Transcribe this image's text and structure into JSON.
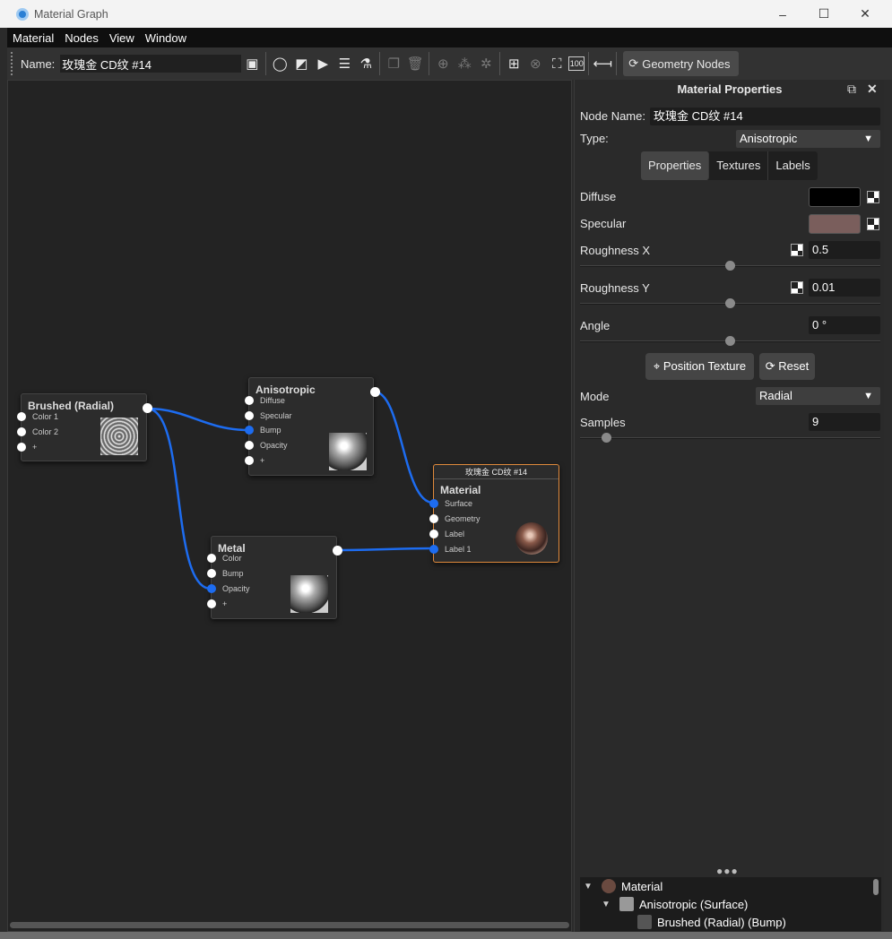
{
  "window": {
    "title": "Material Graph",
    "controls": [
      "–",
      "☐",
      "✕"
    ]
  },
  "menu": [
    "Material",
    "Nodes",
    "View",
    "Window"
  ],
  "toolbar": {
    "name_label": "Name:",
    "name_value": "玫瑰金 CD纹 #14",
    "geometry_button": "Geometry Nodes",
    "icons": [
      "save-icon",
      "search-icon",
      "checker-icon",
      "play-icon",
      "sliders-icon",
      "flask-icon",
      "copy-icon",
      "trash-icon",
      "add-node-icon",
      "random-icon",
      "sparkle-icon",
      "layout-icon",
      "crosshair-icon",
      "fit-icon",
      "zoom-100-icon",
      "collapse-icon"
    ]
  },
  "graph": {
    "nodes": {
      "brushed": {
        "title": "Brushed (Radial)",
        "inputs": [
          "Color 1",
          "Color 2",
          "+"
        ]
      },
      "aniso": {
        "title": "Anisotropic",
        "inputs": [
          "Diffuse",
          "Specular",
          "Bump",
          "Opacity",
          "+"
        ]
      },
      "metal": {
        "title": "Metal",
        "inputs": [
          "Color",
          "Bump",
          "Opacity",
          "+"
        ]
      },
      "material": {
        "header": "玫瑰金 CD纹 #14",
        "title": "Material",
        "inputs": [
          "Surface",
          "Geometry",
          "Label",
          "Label 1"
        ]
      }
    }
  },
  "panel": {
    "title": "Material Properties",
    "node_name_label": "Node Name:",
    "node_name_value": "玫瑰金 CD纹 #14",
    "type_label": "Type:",
    "type_value": "Anisotropic",
    "tabs": [
      "Properties",
      "Textures",
      "Labels"
    ],
    "diffuse_label": "Diffuse",
    "diffuse_color": "#000000",
    "specular_label": "Specular",
    "specular_color": "#7a5e5c",
    "roughness_x_label": "Roughness X",
    "roughness_x_value": "0.5",
    "roughness_y_label": "Roughness Y",
    "roughness_y_value": "0.01",
    "angle_label": "Angle",
    "angle_value": "0 °",
    "position_texture_button": "Position Texture",
    "reset_button": "Reset",
    "mode_label": "Mode",
    "mode_value": "Radial",
    "samples_label": "Samples",
    "samples_value": "9",
    "tree": [
      "Material",
      "Anisotropic (Surface)",
      "Brushed (Radial) (Bump)"
    ]
  },
  "colors": {
    "wire": "#1d6cf0",
    "material_border": "#e08a3c",
    "accent": "#1d6cf0"
  }
}
